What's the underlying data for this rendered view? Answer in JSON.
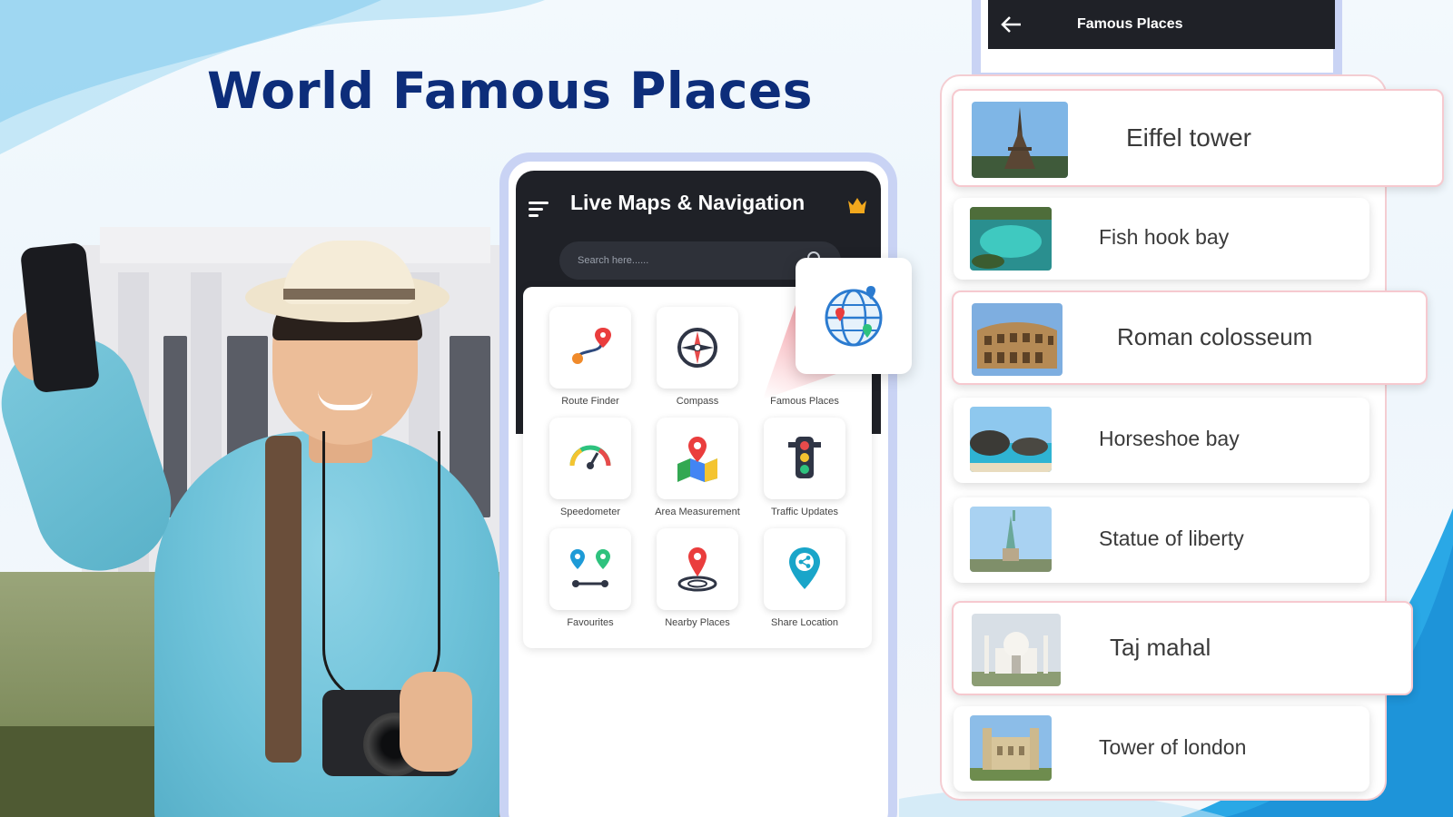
{
  "headline": "World Famous Places",
  "app": {
    "title": "Live Maps & Navigation",
    "search_placeholder": "Search here......",
    "tiles": [
      {
        "label": "Route Finder",
        "icon": "route-finder-icon"
      },
      {
        "label": "Compass",
        "icon": "compass-icon"
      },
      {
        "label": "Famous Places",
        "icon": "globe-icon"
      },
      {
        "label": "Speedometer",
        "icon": "speedometer-icon"
      },
      {
        "label": "Area Measurement",
        "icon": "area-map-icon"
      },
      {
        "label": "Traffic Updates",
        "icon": "traffic-light-icon"
      },
      {
        "label": "Favourites",
        "icon": "favourites-icon"
      },
      {
        "label": "Nearby Places",
        "icon": "nearby-pin-icon"
      },
      {
        "label": "Share Location",
        "icon": "share-location-icon"
      }
    ]
  },
  "places_screen": {
    "title": "Famous Places",
    "places": [
      {
        "name": "Eiffel tower"
      },
      {
        "name": "Fish hook bay"
      },
      {
        "name": "Roman colosseum"
      },
      {
        "name": "Horseshoe bay"
      },
      {
        "name": "Statue of liberty"
      },
      {
        "name": "Taj mahal"
      },
      {
        "name": "Tower of london"
      }
    ]
  },
  "colors": {
    "headline": "#0d2d7a",
    "header_bg": "#1f2127",
    "phone_frame": "#c9d3f4",
    "accent_red": "#f05a66",
    "crown": "#f2a81d"
  }
}
